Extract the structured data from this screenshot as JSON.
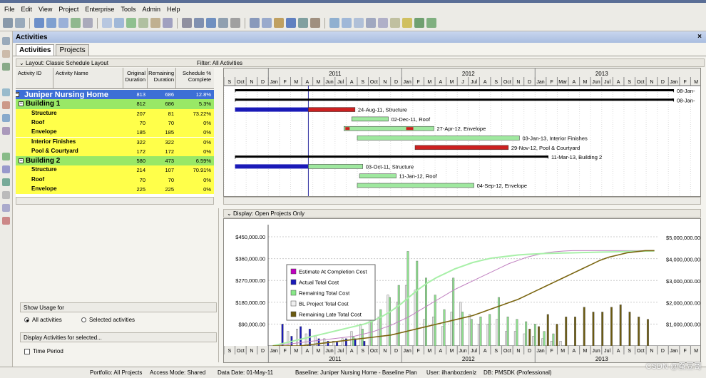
{
  "menu": [
    "File",
    "Edit",
    "View",
    "Project",
    "Enterprise",
    "Tools",
    "Admin",
    "Help"
  ],
  "panel": {
    "title": "Activities",
    "close": "×"
  },
  "tabs": [
    {
      "label": "Activities",
      "active": true
    },
    {
      "label": "Projects",
      "active": false
    }
  ],
  "layout": {
    "label": "Layout: Classic Schedule Layout",
    "filter": "Filter: All Activities"
  },
  "columns": {
    "id": "Activity ID",
    "name": "Activity Name",
    "orig": "Original\nDuration",
    "rem": "Remaining\nDuration",
    "sched": "Schedule %\nComplete"
  },
  "rows": [
    {
      "name": "Juniper Nursing Home",
      "orig": "813",
      "rem": "686",
      "pct": "12.8%",
      "level": 0
    },
    {
      "name": "Building 1",
      "orig": "812",
      "rem": "686",
      "pct": "5.3%",
      "level": 1
    },
    {
      "name": "Structure",
      "orig": "207",
      "rem": "81",
      "pct": "73.22%",
      "level": 2
    },
    {
      "name": "Roof",
      "orig": "70",
      "rem": "70",
      "pct": "0%",
      "level": 2
    },
    {
      "name": "Envelope",
      "orig": "185",
      "rem": "185",
      "pct": "0%",
      "level": 2
    },
    {
      "name": "Interior Finishes",
      "orig": "322",
      "rem": "322",
      "pct": "0%",
      "level": 2
    },
    {
      "name": "Pool & Courtyard",
      "orig": "172",
      "rem": "172",
      "pct": "0%",
      "level": 2
    },
    {
      "name": "Building 2",
      "orig": "580",
      "rem": "473",
      "pct": "6.59%",
      "level": 1
    },
    {
      "name": "Structure",
      "orig": "214",
      "rem": "107",
      "pct": "70.91%",
      "level": 2
    },
    {
      "name": "Roof",
      "orig": "70",
      "rem": "70",
      "pct": "0%",
      "level": 2
    },
    {
      "name": "Envelope",
      "orig": "225",
      "rem": "225",
      "pct": "0%",
      "level": 2
    }
  ],
  "timeline": {
    "years": [
      "2011",
      "2012",
      "2013"
    ],
    "months": [
      "S",
      "Oct",
      "N",
      "D",
      "Jan",
      "F",
      "M",
      "A",
      "M",
      "Jun",
      "Jul",
      "A",
      "S",
      "Oct",
      "N",
      "D",
      "Jan",
      "F",
      "M",
      "A",
      "M",
      "J",
      "Jul",
      "A",
      "S",
      "Oct",
      "N",
      "D",
      "Jan",
      "F",
      "Mar",
      "A",
      "M",
      "Jun",
      "Jul",
      "A",
      "S",
      "Oct",
      "N",
      "D",
      "Jan",
      "F",
      "M"
    ],
    "bottom_months": [
      "S",
      "Oct",
      "N",
      "D",
      "Jan",
      "F",
      "M",
      "A",
      "M",
      "Jun",
      "Jul",
      "A",
      "S",
      "Oct",
      "N",
      "D",
      "Jan",
      "F",
      "M",
      "A",
      "M",
      "Jun",
      "Jul",
      "A",
      "S",
      "Oct",
      "N",
      "D",
      "Jan",
      "F",
      "M",
      "A",
      "M",
      "Jun",
      "Jul",
      "A",
      "S",
      "Oct",
      "N",
      "D",
      "Jan",
      "F",
      "M"
    ]
  },
  "gantt_labels": [
    {
      "text": "08-Jan-"
    },
    {
      "text": "08-Jan-"
    },
    {
      "text": "24-Aug-11, Structure"
    },
    {
      "text": "02-Dec-11, Roof"
    },
    {
      "text": "27-Apr-12, Envelope"
    },
    {
      "text": "03-Jan-13, Interior Finishes"
    },
    {
      "text": "29-Nov-12, Pool & Courtyard"
    },
    {
      "text": "11-Mar-13, Building 2"
    },
    {
      "text": "03-Oct-11, Structure"
    },
    {
      "text": "11-Jan-12, Roof"
    },
    {
      "text": "04-Sep-12, Envelope"
    }
  ],
  "display": {
    "label": "Display: Open Projects Only"
  },
  "usage": {
    "show_usage": "Show Usage for",
    "all": "All activities",
    "selected": "Selected activities",
    "display_for": "Display Activities for selected...",
    "time_period": "Time Period"
  },
  "legend": [
    {
      "label": "Estimate At Completion Cost",
      "color": "#c000c0"
    },
    {
      "label": "Actual Total Cost",
      "color": "#1a1ab8"
    },
    {
      "label": "Remaining Total Cost",
      "color": "#88e888"
    },
    {
      "label": "BL Project Total Cost",
      "color": "#f0f0f0"
    },
    {
      "label": "Remaining Late Total Cost",
      "color": "#6b5a10"
    }
  ],
  "chart_data": {
    "type": "bar",
    "left_axis_ticks": [
      "$450,000.00",
      "$360,000.00",
      "$270,000.00",
      "$180,000.00",
      "$90,000.00"
    ],
    "right_axis_ticks": [
      "$5,000,000.00",
      "$4,000,000.00",
      "$3,000,000.00",
      "$2,000,000.00",
      "$1,000,000.00"
    ],
    "ylim": [
      0,
      500000
    ],
    "y2lim": [
      0,
      5600000
    ],
    "periods": 43,
    "series": [
      {
        "name": "Actual Total Cost",
        "values": [
          0,
          90,
          40,
          80,
          70,
          30,
          20,
          15,
          30,
          30,
          20,
          0,
          0,
          0,
          0,
          0,
          0,
          0,
          0,
          0,
          0,
          0,
          0,
          0,
          0,
          0,
          0,
          0,
          0,
          0,
          0,
          0,
          0,
          0,
          0,
          0,
          0,
          0,
          0,
          0,
          0,
          0,
          0
        ]
      },
      {
        "name": "BL Project Total Cost",
        "values": [
          0,
          0,
          60,
          70,
          50,
          40,
          30,
          20,
          30,
          60,
          90,
          150,
          120,
          210,
          180,
          250,
          230,
          110,
          120,
          80,
          140,
          180,
          130,
          90,
          90,
          110,
          60,
          60,
          50,
          40,
          30,
          20,
          20,
          0,
          0,
          0,
          0,
          0,
          0,
          0,
          0,
          0,
          0
        ]
      },
      {
        "name": "Remaining Total Cost",
        "values": [
          0,
          0,
          0,
          0,
          0,
          0,
          0,
          0,
          0,
          40,
          70,
          110,
          150,
          200,
          250,
          390,
          350,
          280,
          210,
          150,
          280,
          140,
          110,
          120,
          130,
          200,
          120,
          110,
          100,
          90,
          60,
          50,
          0,
          0,
          0,
          0,
          0,
          0,
          0,
          0,
          0,
          0,
          0
        ]
      },
      {
        "name": "Remaining Late Total Cost",
        "values": [
          0,
          0,
          0,
          0,
          0,
          0,
          0,
          0,
          0,
          0,
          0,
          0,
          0,
          0,
          0,
          0,
          0,
          0,
          0,
          0,
          0,
          0,
          0,
          0,
          0,
          0,
          0,
          0,
          70,
          80,
          130,
          90,
          120,
          120,
          160,
          140,
          140,
          160,
          170,
          140,
          120,
          110,
          0
        ]
      },
      {
        "name": "Estimate At Completion Cost",
        "values": [
          0,
          0,
          0,
          0,
          0,
          0,
          0,
          0,
          0,
          0,
          0,
          0,
          0,
          0,
          0,
          0,
          0,
          0,
          0,
          0,
          0,
          0,
          0,
          0,
          0,
          0,
          0,
          0,
          0,
          0,
          0,
          0,
          0,
          0,
          0,
          0,
          0,
          0,
          0,
          0,
          0,
          0,
          0
        ]
      }
    ],
    "cum_remaining": [
      0,
      100000,
      200000,
      300000,
      400000,
      500000,
      600000,
      700000,
      800000,
      900000,
      1000000,
      1150000,
      1350000,
      1600000,
      1900000,
      2250000,
      2600000,
      2900000,
      3150000,
      3350000,
      3550000,
      3700000,
      3850000,
      3950000,
      4050000,
      4100000,
      4150000,
      4200000,
      4230000,
      4250000,
      4270000,
      4280000,
      4290000,
      4300000,
      4310000,
      4320000,
      4330000,
      4340000,
      4350000,
      4360000,
      4370000,
      4380000,
      4390000
    ],
    "cum_late": [
      0,
      0,
      0,
      0,
      50000,
      100000,
      150000,
      200000,
      250000,
      300000,
      350000,
      400000,
      450000,
      500000,
      600000,
      700000,
      800000,
      900000,
      1000000,
      1100000,
      1200000,
      1300000,
      1400000,
      1550000,
      1700000,
      1850000,
      2000000,
      2150000,
      2350000,
      2550000,
      2750000,
      2950000,
      3150000,
      3350000,
      3550000,
      3750000,
      3950000,
      4100000,
      4200000,
      4300000,
      4350000,
      4400000,
      4400000
    ],
    "cum_bl": [
      0,
      50000,
      100000,
      150000,
      200000,
      250000,
      300000,
      350000,
      400000,
      450000,
      550000,
      650000,
      800000,
      950000,
      1150000,
      1350000,
      1600000,
      1850000,
      2100000,
      2350000,
      2600000,
      2800000,
      3000000,
      3200000,
      3400000,
      3600000,
      3800000,
      3950000,
      4100000,
      4200000,
      4300000,
      4350000,
      4380000,
      4400000,
      4400000,
      4400000,
      4400000,
      4400000,
      4400000,
      4400000,
      4400000,
      4400000,
      4400000
    ]
  },
  "status": {
    "portfolio": "Portfolio: All Projects",
    "access": "Access Mode: Shared",
    "datadate": "Data Date: 01-May-11",
    "baseline": "Baseline: Juniper Nursing Home - Baseline Plan",
    "user": "User: ilhanbozdeniz",
    "db": "DB: PMSDK (Professional)"
  },
  "watermark": "CSDN @蚕豆哥",
  "colors": {
    "topRow": "#3d6fd6",
    "levelRow": "#99e866",
    "taskRow": "#ffff4a",
    "blue": "#1a1ab8",
    "red": "#cc2020",
    "green": "#9fe89f",
    "black": "#000000"
  }
}
